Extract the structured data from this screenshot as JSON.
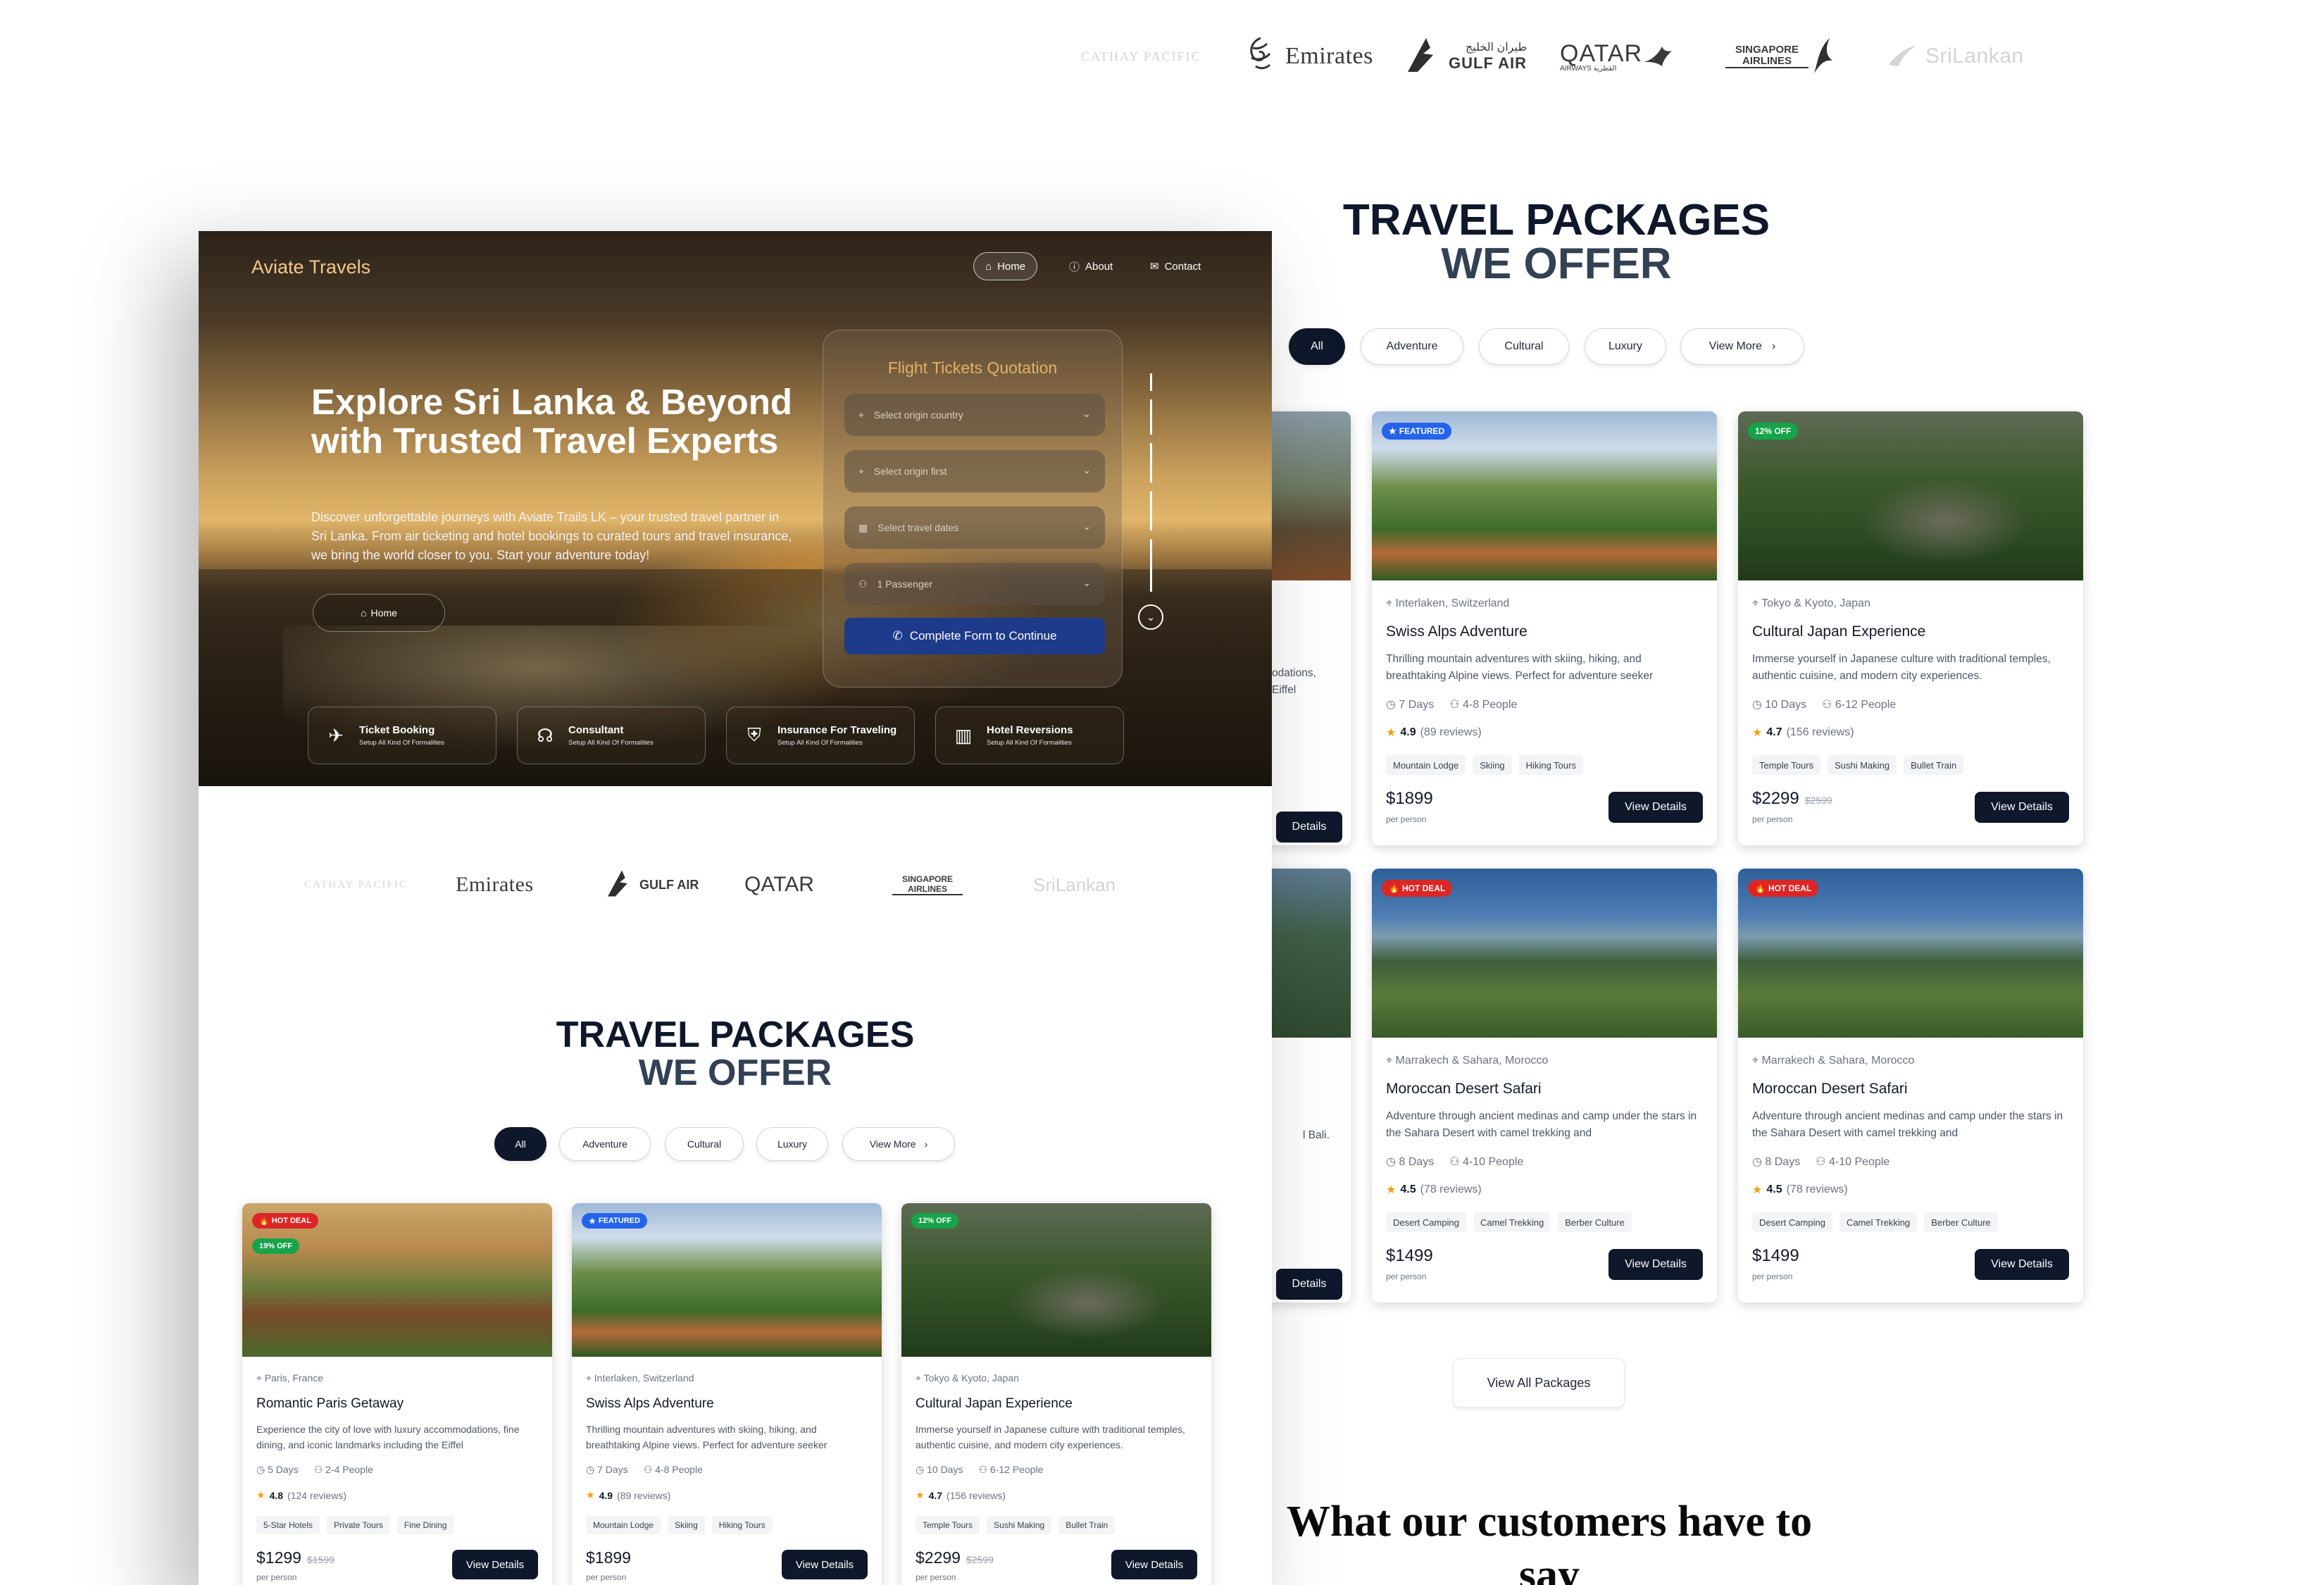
{
  "airlines": [
    "CATHAY PACIFIC",
    "Emirates",
    "GULF AIR",
    "QATAR",
    "SINGAPORE AIRLINES",
    "SriLankan"
  ],
  "airline_arabic": {
    "gulf": "طيران الخليج",
    "qatar": "AIRWAYS القطرية"
  },
  "nav": {
    "brand": "Aviate Travels",
    "home": "Home",
    "about": "About",
    "contact": "Contact"
  },
  "hero": {
    "title": "Explore Sri Lanka & Beyond with Trusted Travel Experts",
    "description": "Discover unforgettable journeys with Aviate Trails LK – your trusted travel partner in Sri Lanka. From air ticketing and hotel bookings to curated tours and travel insurance, we bring the world closer to you. Start your adventure today!",
    "button": "Home"
  },
  "form": {
    "title": "Flight Tickets Quotation",
    "origin_country": "Select origin country",
    "origin_first": "Select origin first",
    "dates": "Select travel dates",
    "passengers": "1 Passenger",
    "submit": "Complete Form to Continue"
  },
  "services": [
    {
      "title": "Ticket Booking",
      "sub": "Setup All Kind Of Formalities"
    },
    {
      "title": "Consultant",
      "sub": "Setup All Kind Of Formalities"
    },
    {
      "title": "Insurance For Traveling",
      "sub": "Setup All Kind Of Formalities"
    },
    {
      "title": "Hotel Reversions",
      "sub": "Setup All Kind Of Formalities"
    }
  ],
  "section": {
    "title": "TRAVEL PACKAGES",
    "subtitle": "WE OFFER"
  },
  "filters": [
    "All",
    "Adventure",
    "Cultural",
    "Luxury",
    "View More"
  ],
  "badges": {
    "hot": "HOT DEAL",
    "featured": "FEATURED",
    "off12": "12% OFF",
    "off19": "19% OFF"
  },
  "packages": {
    "paris": {
      "loc": "Paris, France",
      "title": "Romantic Paris Getaway",
      "desc": "Experience the city of love with luxury accommodations, fine dining, and iconic landmarks including the Eiffel",
      "days": "5 Days",
      "people": "2-4 People",
      "rating": "4.8",
      "reviews": "(124 reviews)",
      "tags": [
        "5-Star Hotels",
        "Private Tours",
        "Fine Dining"
      ],
      "price": "$1299",
      "old": "$1599"
    },
    "swiss": {
      "loc": "Interlaken, Switzerland",
      "title": "Swiss Alps Adventure",
      "desc": "Thrilling mountain adventures with skiing, hiking, and breathtaking Alpine views. Perfect for adventure seeker",
      "days": "7 Days",
      "people": "4-8 People",
      "rating": "4.9",
      "reviews": "(89 reviews)",
      "tags": [
        "Mountain Lodge",
        "Skiing",
        "Hiking Tours"
      ],
      "price": "$1899",
      "old": ""
    },
    "japan": {
      "loc": "Tokyo & Kyoto, Japan",
      "title": "Cultural Japan Experience",
      "desc": "Immerse yourself in Japanese culture with traditional temples, authentic cuisine, and modern city experiences.",
      "days": "10 Days",
      "people": "6-12 People",
      "rating": "4.7",
      "reviews": "(156 reviews)",
      "tags": [
        "Temple Tours",
        "Sushi Making",
        "Bullet Train"
      ],
      "price": "$2299",
      "old": "$2599"
    },
    "morocco": {
      "loc": "Marrakech & Sahara, Morocco",
      "title": "Moroccan Desert Safari",
      "desc": "Adventure through ancient medinas and camp under the stars in the Sahara Desert with camel trekking and",
      "days": "8 Days",
      "people": "4-10 People",
      "rating": "4.5",
      "reviews": "(78 reviews)",
      "tags": [
        "Desert Camping",
        "Camel Trekking",
        "Berber Culture"
      ],
      "price": "$1499",
      "old": ""
    }
  },
  "per_person": "per person",
  "view_details": "View Details",
  "partial": {
    "bg1": "odations,",
    "bg2": "Eiffel",
    "bg3": "l Bali.",
    "btn": "Details"
  },
  "view_all": "View All Packages",
  "testimonial_heading": "What our customers have to say",
  "colors": {
    "navy": "#0f172a",
    "hot": "#dc2626",
    "featured": "#2563eb",
    "off": "#16a34a",
    "gold": "#e2b268"
  }
}
